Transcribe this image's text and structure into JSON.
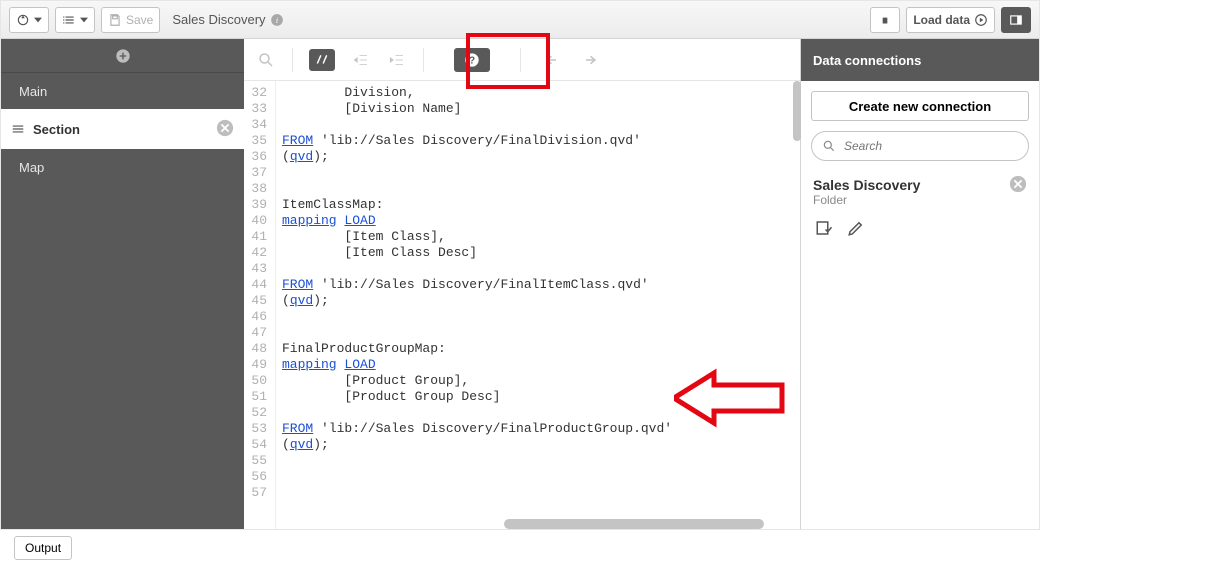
{
  "topbar": {
    "save_label": "Save",
    "title": "Sales Discovery",
    "load_label": "Load data"
  },
  "left": {
    "items": [
      "Main",
      "Map"
    ],
    "section_label": "Section",
    "output_label": "Output"
  },
  "editor": {
    "lines": [
      {
        "n": 32,
        "plain": "        Division,"
      },
      {
        "n": 33,
        "plain": "        [Division Name]"
      },
      {
        "n": 34,
        "plain": ""
      },
      {
        "n": 35,
        "kw1": "FROM",
        "tail": " 'lib://Sales Discovery/FinalDivision.qvd'"
      },
      {
        "n": 36,
        "pre": "(",
        "kw1": "qvd",
        "tail": ");"
      },
      {
        "n": 37,
        "plain": ""
      },
      {
        "n": 38,
        "plain": ""
      },
      {
        "n": 39,
        "plain": "ItemClassMap:"
      },
      {
        "n": 40,
        "kw1": "mapping",
        "kw2": "LOAD"
      },
      {
        "n": 41,
        "plain": "        [Item Class],"
      },
      {
        "n": 42,
        "plain": "        [Item Class Desc]"
      },
      {
        "n": 43,
        "plain": ""
      },
      {
        "n": 44,
        "kw1": "FROM",
        "tail": " 'lib://Sales Discovery/FinalItemClass.qvd'"
      },
      {
        "n": 45,
        "pre": "(",
        "kw1": "qvd",
        "tail": ");"
      },
      {
        "n": 46,
        "plain": ""
      },
      {
        "n": 47,
        "plain": ""
      },
      {
        "n": 48,
        "plain": "FinalProductGroupMap:"
      },
      {
        "n": 49,
        "kw1": "mapping",
        "kw2": "LOAD"
      },
      {
        "n": 50,
        "plain": "        [Product Group],"
      },
      {
        "n": 51,
        "plain": "        [Product Group Desc]"
      },
      {
        "n": 52,
        "plain": ""
      },
      {
        "n": 53,
        "kw1": "FROM",
        "tail": " 'lib://Sales Discovery/FinalProductGroup.qvd'"
      },
      {
        "n": 54,
        "pre": "(",
        "kw1": "qvd",
        "tail": ");"
      },
      {
        "n": 55,
        "plain": ""
      },
      {
        "n": 56,
        "plain": ""
      },
      {
        "n": 57,
        "plain": ""
      }
    ]
  },
  "right": {
    "header": "Data connections",
    "create_label": "Create new connection",
    "search_placeholder": "Search",
    "conn_title": "Sales Discovery",
    "conn_sub": "Folder"
  }
}
